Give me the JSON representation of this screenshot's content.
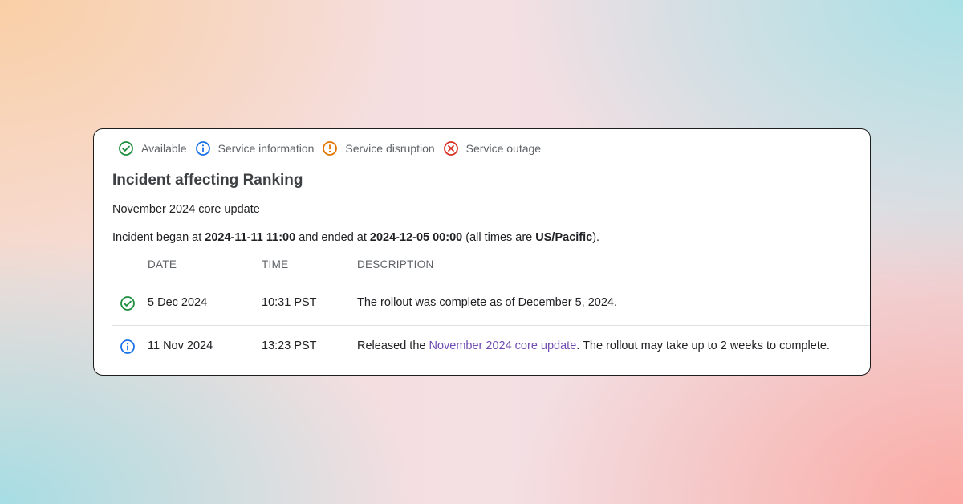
{
  "legend": [
    {
      "icon": "check-circle-icon",
      "label": "Available",
      "color": "#1e8e3e"
    },
    {
      "icon": "info-circle-icon",
      "label": "Service information",
      "color": "#1a73e8"
    },
    {
      "icon": "warning-circle-icon",
      "label": "Service disruption",
      "color": "#e37400"
    },
    {
      "icon": "x-circle-icon",
      "label": "Service outage",
      "color": "#d93025"
    }
  ],
  "incident": {
    "title": "Incident affecting Ranking",
    "subtitle": "November 2024 core update",
    "summary": {
      "prefix": "Incident began at ",
      "start": "2024-11-11 11:00",
      "middle": " and ended at ",
      "end": "2024-12-05 00:00",
      "tz_prefix": " (all times are ",
      "tz": "US/Pacific",
      "suffix": ")."
    }
  },
  "table": {
    "headers": {
      "date": "DATE",
      "time": "TIME",
      "description": "DESCRIPTION"
    },
    "rows": [
      {
        "status_icon": "check-circle-icon",
        "date": "5 Dec 2024",
        "time": "10:31 PST",
        "description_before": "The rollout was complete as of December 5, 2024.",
        "link_text": "",
        "description_after": ""
      },
      {
        "status_icon": "info-circle-icon",
        "date": "11 Nov 2024",
        "time": "13:23 PST",
        "description_before": "Released the ",
        "link_text": "November 2024 core update",
        "description_after": ". The rollout may take up to 2 weeks to complete."
      }
    ]
  },
  "colors": {
    "link": "#6f4bb0",
    "text": "#202124",
    "muted": "#5f6368",
    "card_border": "#1d1d1d"
  }
}
